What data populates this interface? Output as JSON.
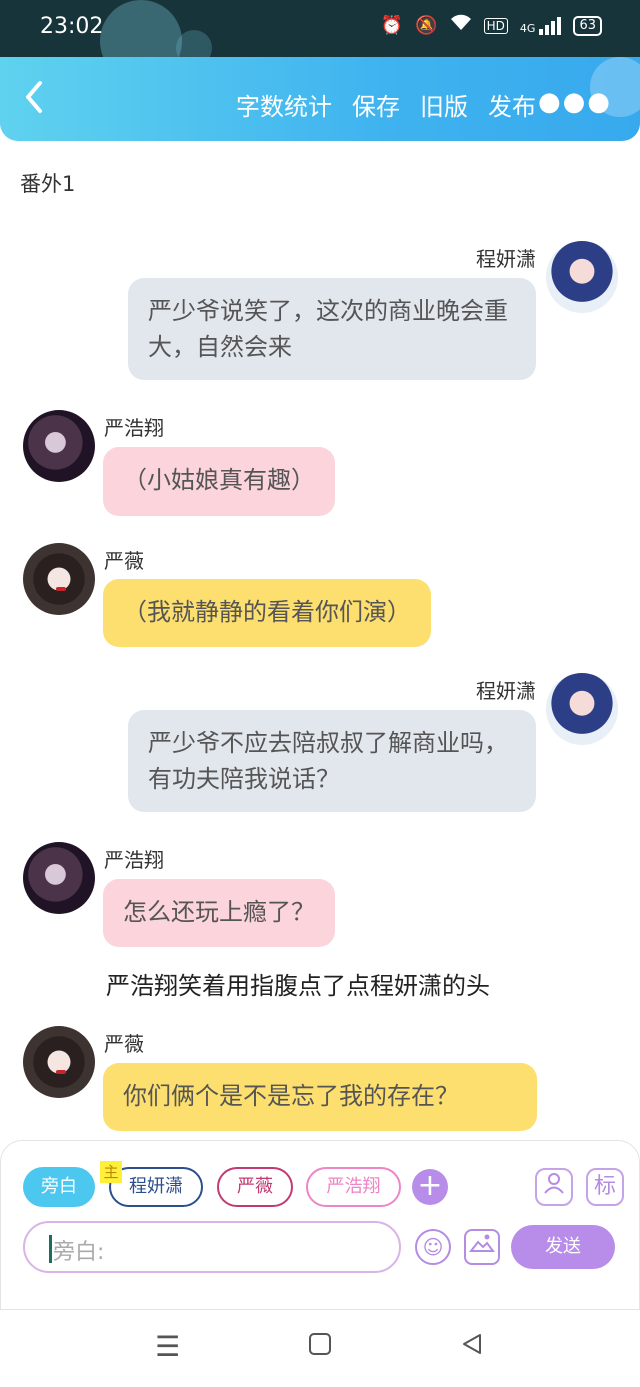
{
  "status_bar": {
    "time": "23:02",
    "icons": [
      "alarm-icon",
      "mute-bell-icon",
      "wifi-icon",
      "hd-icon",
      "signal-4g-icon"
    ],
    "hd_label": "HD",
    "net_label": "4G",
    "battery": "63"
  },
  "top_bar": {
    "back_icon": "chevron-left-icon",
    "actions": [
      "字数统计",
      "保存",
      "旧版",
      "发布"
    ],
    "more_icon": "more-dots-icon",
    "accent_color": "#3fb3ef"
  },
  "chapter_title": "番外1",
  "messages": [
    {
      "speaker": "程妍潇",
      "side": "right",
      "text": "严少爷说笑了，这次的商业晚会重大，自然会来"
    },
    {
      "speaker": "严浩翔",
      "side": "left",
      "text": "（小姑娘真有趣）"
    },
    {
      "speaker": "严薇",
      "side": "left",
      "text": "（我就静静的看着你们演）"
    },
    {
      "speaker": "程妍潇",
      "side": "right",
      "text": "严少爷不应去陪叔叔了解商业吗，有功夫陪我说话？"
    },
    {
      "speaker": "严浩翔",
      "side": "left",
      "text": "怎么还玩上瘾了？"
    }
  ],
  "narration": "严浩翔笑着用指腹点了点程妍潇的头",
  "message_last": {
    "speaker": "严薇",
    "side": "left",
    "text": "你们俩个是不是忘了我的存在？"
  },
  "bubble_colors": {
    "程妍潇": "#e2e7ee",
    "严浩翔": "#fbd4dc",
    "严薇": "#fcdf6e"
  },
  "composer": {
    "roles": [
      "旁白",
      "程妍潇",
      "严薇",
      "严浩翔"
    ],
    "main_badge": "主",
    "add_icon": "plus-icon",
    "character_icon": "person-card-icon",
    "tag_label": "标",
    "placeholder": "旁白:",
    "emoji_icon": "smiley-icon",
    "image_icon": "image-icon",
    "send_label": "发送",
    "send_color": "#b88dea"
  },
  "nav_bar": {
    "icons": [
      "menu-icon",
      "home-square-icon",
      "back-triangle-icon"
    ]
  }
}
